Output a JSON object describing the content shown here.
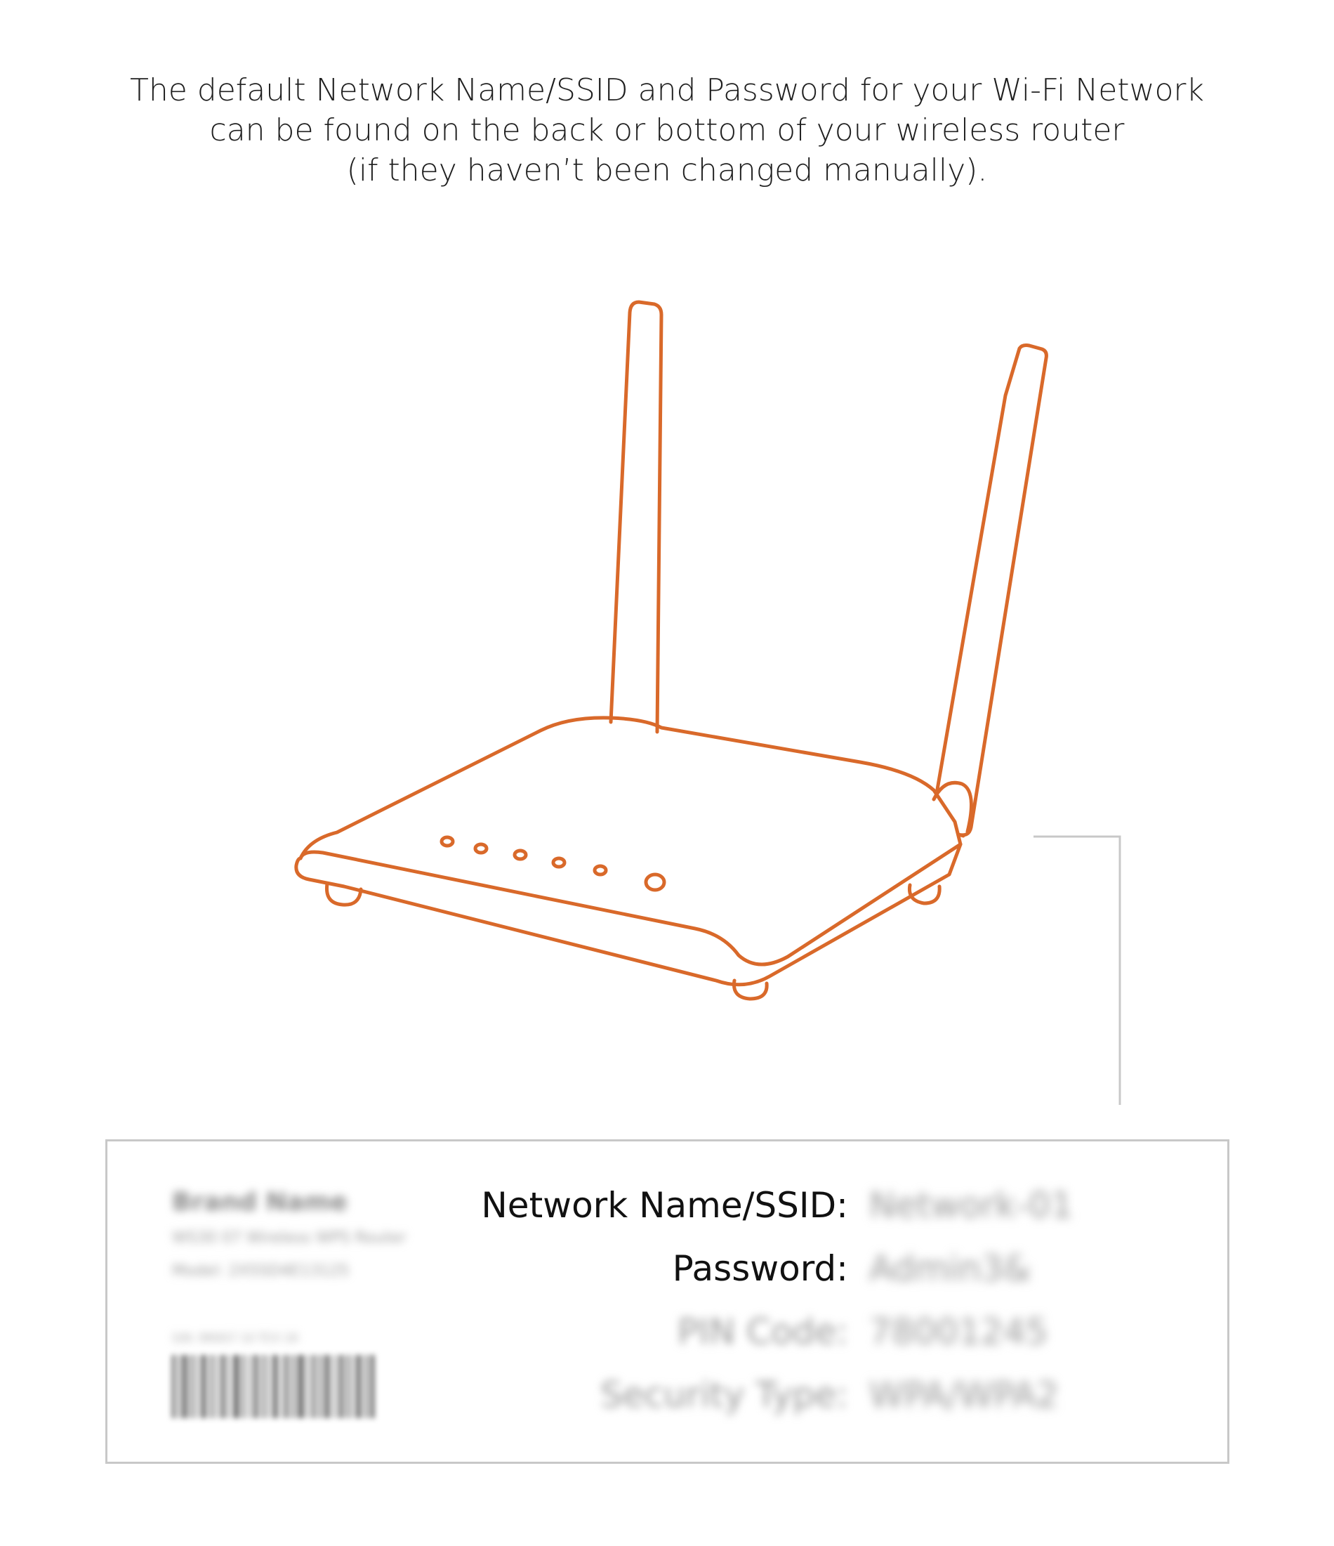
{
  "intro": {
    "line1": "The default Network Name/SSID and Password for your Wi-Fi Network",
    "line2": "can be found on the back or bottom of your wireless router",
    "line3": "(if they haven’t been changed manually)."
  },
  "colors": {
    "router_stroke": "#d9692a",
    "connector_line": "#c8c8c8",
    "panel_border": "#c8c8c8"
  },
  "illustration": {
    "icon": "wireless-router-icon"
  },
  "label": {
    "brand_name": "Brand Name",
    "brand_model_line": "WS30 07 Wireless WPS Router",
    "brand_serial_line": "Model: 2X5SD4E13125",
    "barcode_caption": "S/N: 9M4S7 10 TCX 18",
    "fields": [
      {
        "label": "Network Name/SSID:",
        "value": "Network-01",
        "blurred": false
      },
      {
        "label": "Password:",
        "value": "Admin3&",
        "blurred": false
      },
      {
        "label": "PIN Code:",
        "value": "78001245",
        "blurred": true
      },
      {
        "label": "Security Type:",
        "value": "WPA/WPA2",
        "blurred": true
      }
    ]
  }
}
